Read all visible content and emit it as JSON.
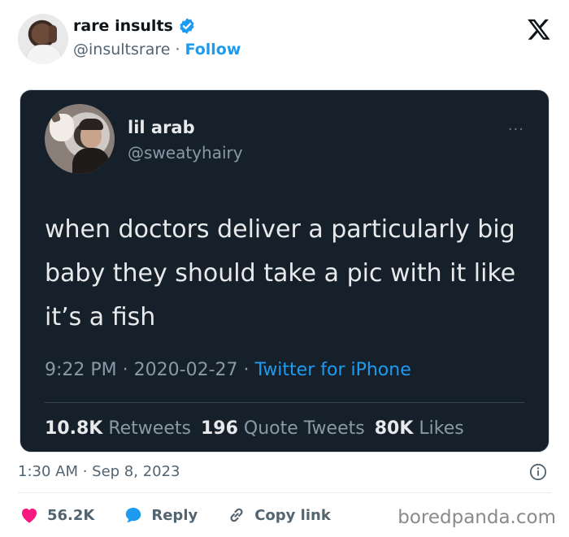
{
  "author": {
    "display_name": "rare insults",
    "handle": "@insultsrare",
    "separator": "·",
    "follow_label": "Follow"
  },
  "embedded_tweet": {
    "display_name": "lil arab",
    "handle": "@sweatyhairy",
    "more": "···",
    "text": "when doctors deliver a particularly big baby they should take a pic with it like it’s a fish",
    "time": "9:22 PM",
    "sep1": "·",
    "date": "2020-02-27",
    "sep2": "·",
    "source": "Twitter for iPhone",
    "retweets_count": "10.8K",
    "retweets_label": "Retweets",
    "quotes_count": "196",
    "quotes_label": "Quote Tweets",
    "likes_count": "80K",
    "likes_label": "Likes"
  },
  "timestamp": "1:30 AM · Sep 8, 2023",
  "actions": {
    "likes": "56.2K",
    "reply": "Reply",
    "copy_link": "Copy link"
  },
  "watermark": "boredpanda.com",
  "colors": {
    "accent": "#1d9bf0",
    "like": "#f91880",
    "card_bg": "#15202b"
  }
}
